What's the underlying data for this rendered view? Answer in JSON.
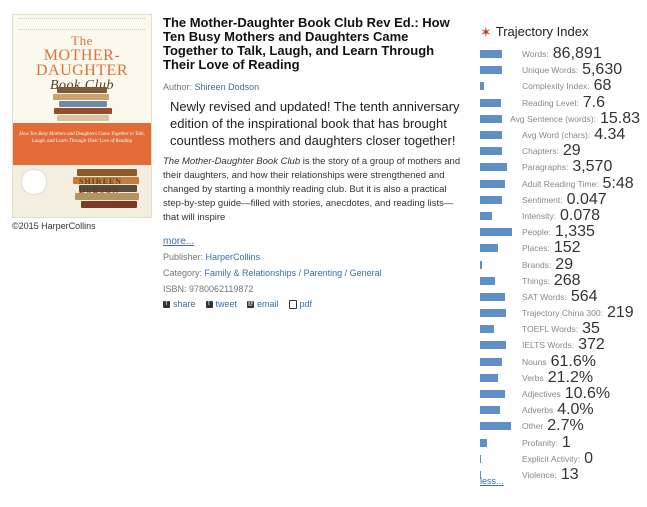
{
  "cover": {
    "title_line1": "The",
    "title_line2": "MOTHER-DAUGHTER",
    "title_line3": "Book Club",
    "author_on_cover": "SHIREEN DODSON",
    "band_text": "How Ten Busy Mothers and Daughters Came Together to Talk, Laugh, and Learn Through Their Love of Reading"
  },
  "copyright": "©2015 HarperCollins",
  "book": {
    "title": "The Mother-Daughter Book Club Rev Ed.: How Ten Busy Mothers and Daughters Came Together to Talk, Laugh, and Learn Through Their Love of Reading",
    "author_label": "Author:",
    "author": "Shireen Dodson",
    "lead": "Newly revised and updated! The tenth anniversary edition of the inspirational book that has brought countless mothers and daughters closer together!",
    "description_title": "The Mother-Daughter Book Club",
    "description_rest": " is the story of a group of mothers and their daughters, and how their relationships were strengthened and changed by starting a monthly reading club. But it is also a practical step-by-step guide—filled with stories, anecdotes, and reading lists—that will inspire",
    "more": "more...",
    "publisher_label": "Publisher:",
    "publisher": "HarperCollins",
    "category_label": "Category:",
    "categories": "Family & Relationships / Parenting / General",
    "isbn_label": "ISBN:",
    "isbn": "9780062119872"
  },
  "share": {
    "share": "share",
    "tweet": "tweet",
    "email": "email",
    "pdf": "pdf"
  },
  "trajectory": {
    "title": "Trajectory Index",
    "less": "less...",
    "bar_color": "#5e8fc7",
    "metrics": [
      {
        "label": "Words:",
        "value": "86,891",
        "fill": 0.62
      },
      {
        "label": "Unique Words:",
        "value": "5,630",
        "fill": 0.6
      },
      {
        "label": "Complexity Index:",
        "value": "68",
        "fill": 0.12
      },
      {
        "label": "Reading Level:",
        "value": "7.6",
        "fill": 0.58
      },
      {
        "label": "Avg Sentence (words):",
        "value": "15.83",
        "fill": 0.6
      },
      {
        "label": "Avg Word (chars):",
        "value": "4.34",
        "fill": 0.6
      },
      {
        "label": "Chapters:",
        "value": "29",
        "fill": 0.6
      },
      {
        "label": "Paragraphs:",
        "value": "3,570",
        "fill": 0.75
      },
      {
        "label": "Adult Reading Time:",
        "value": "5:48",
        "fill": 0.7
      },
      {
        "label": "Sentiment:",
        "value": "0.047",
        "fill": 0.62
      },
      {
        "label": "Intensity:",
        "value": "0.078",
        "fill": 0.32
      },
      {
        "label": "People:",
        "value": "1,335",
        "fill": 0.88
      },
      {
        "label": "Places:",
        "value": "152",
        "fill": 0.5
      },
      {
        "label": "Brands:",
        "value": "29",
        "fill": 0.06
      },
      {
        "label": "Things:",
        "value": "268",
        "fill": 0.42
      },
      {
        "label": "SAT Words:",
        "value": "564",
        "fill": 0.7
      },
      {
        "label": "Trajectory China 300:",
        "value": "219",
        "fill": 0.72
      },
      {
        "label": "TOEFL Words:",
        "value": "35",
        "fill": 0.38
      },
      {
        "label": "IELTS Words:",
        "value": "372",
        "fill": 0.72
      },
      {
        "label": "Nouns",
        "value": "61.6%",
        "fill": 0.6
      },
      {
        "label": "Verbs",
        "value": "21.2%",
        "fill": 0.5
      },
      {
        "label": "Adjectives",
        "value": "10.6%",
        "fill": 0.7
      },
      {
        "label": "Adverbs",
        "value": "4.0%",
        "fill": 0.55
      },
      {
        "label": "Other",
        "value": "2.7%",
        "fill": 0.85
      },
      {
        "label": "Profanity:",
        "value": "1",
        "fill": 0.2
      },
      {
        "label": "Explicit Activity:",
        "value": "0",
        "fill": 0.04
      },
      {
        "label": "Violence:",
        "value": "13",
        "fill": 0.04
      }
    ]
  }
}
